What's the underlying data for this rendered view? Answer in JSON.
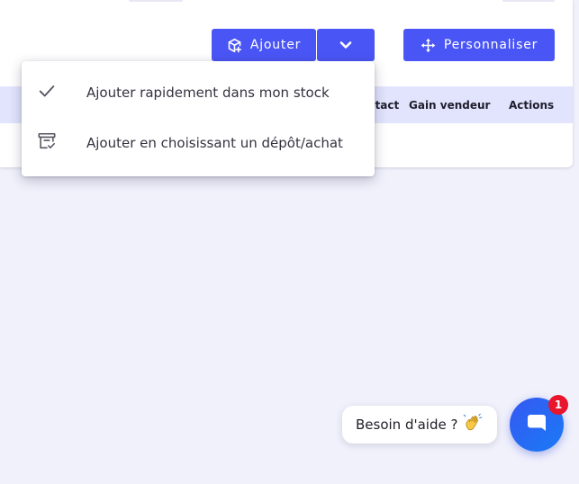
{
  "toolbar": {
    "add_label": "Ajouter",
    "customize_label": "Personnaliser",
    "icons": {
      "add": "box-add-icon",
      "toggle": "chevron-down-icon",
      "customize": "move-arrows-icon"
    }
  },
  "table": {
    "columns": [
      "ntact",
      "Gain vendeur",
      "Actions"
    ]
  },
  "add_menu": {
    "items": [
      {
        "label": "Ajouter rapidement dans mon stock",
        "icon": "check-icon"
      },
      {
        "label": "Ajouter en choisissant un dépôt/achat",
        "icon": "archive-check-icon"
      }
    ]
  },
  "help": {
    "label": "Besoin d'aide ?",
    "icon": "waving-hand-icon"
  },
  "chat": {
    "badge_count": "1",
    "icon": "chat-bubble-icon"
  },
  "colors": {
    "primary": "#4a55f5",
    "page_background": "#f1f1fc",
    "table_header": "#e2e4fd",
    "badge": "#e8152c"
  }
}
